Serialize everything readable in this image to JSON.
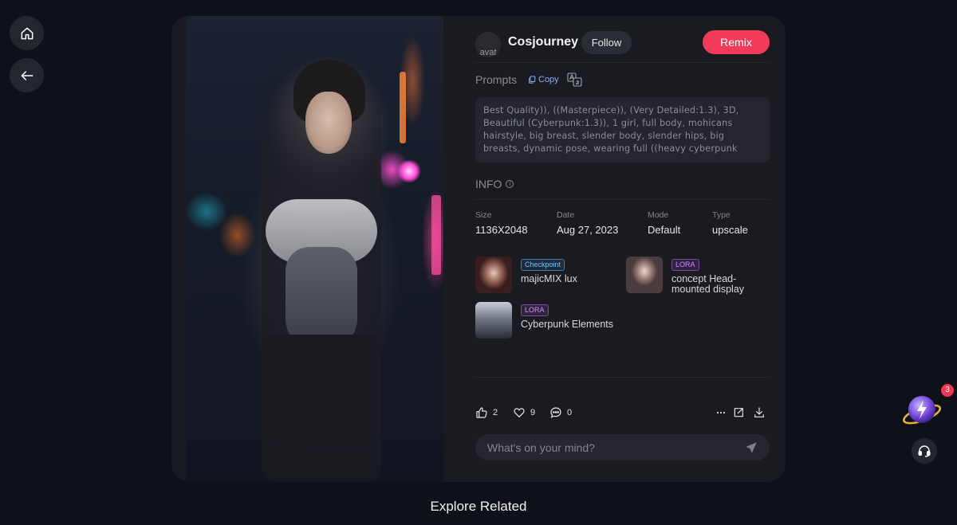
{
  "author": {
    "name": "Cosjourney",
    "avatar_alt": "avat"
  },
  "buttons": {
    "follow": "Follow",
    "remix": "Remix",
    "copy": "Copy"
  },
  "prompts": {
    "label": "Prompts",
    "text": "Best Quality)), ((Masterpiece)), (Very Detailed:1.3), 3D, Beautiful (Cyberpunk:1.3)), 1 girl, full body, mohicans hairstyle, big breast, slender body, slender hips, big breasts, dynamic pose, wearing full ((heavy cyberpunk"
  },
  "info": {
    "label": "INFO",
    "size_label": "Size",
    "size": "1136X2048",
    "date_label": "Date",
    "date": "Aug 27, 2023",
    "mode_label": "Mode",
    "mode": "Default",
    "type_label": "Type",
    "type": "upscale"
  },
  "models": [
    {
      "badge": "Checkpoint",
      "name": "majicMIX lux"
    },
    {
      "badge": "LORA",
      "name": "concept Head-mounted display"
    },
    {
      "badge": "LORA",
      "name": "Cyberpunk Elements"
    }
  ],
  "stats": {
    "likes": "2",
    "favorites": "9",
    "comments": "0"
  },
  "comment": {
    "placeholder": "What's on your mind?"
  },
  "explore": "Explore Related",
  "notifications": "3",
  "colors": {
    "accent": "#f23a5a",
    "background": "#0f1119",
    "card": "#1a1b20"
  },
  "icons": [
    "home-icon",
    "back-arrow-icon",
    "copy-icon",
    "translate-icon",
    "info-icon",
    "thumbs-up-icon",
    "heart-icon",
    "comment-icon",
    "more-icon",
    "share-icon",
    "download-icon",
    "send-icon",
    "headset-icon"
  ]
}
